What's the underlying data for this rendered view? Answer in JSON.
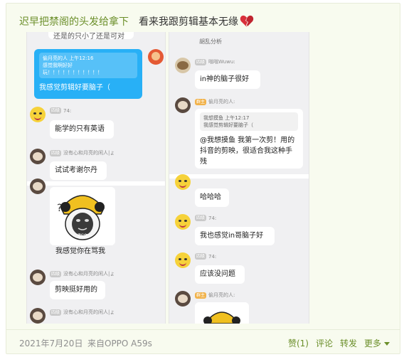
{
  "post": {
    "author": "迟早把禁阁的头发给拿下",
    "text": "看来我跟剪辑基本无缘",
    "heart_icon": "broken-heart-icon"
  },
  "left_screenshot": {
    "top_clip": "还是的只小了还是可对",
    "reply": {
      "quote_header": "偷月亮的人 上午12:16",
      "quote_line1": "感觉我啊好好",
      "quote_line2": "玩！！！！！！！！！！！",
      "text": "我感觉剪辑好要脑子（"
    },
    "msg1": {
      "level": "四级",
      "meta": "74:",
      "text": "能学的只有英语"
    },
    "msg2": {
      "level": "四级",
      "meta": "没有心和月亮的闲人|ょ",
      "text": "试试考谢尔丹"
    },
    "sticker": {
      "caption": "剩这"
    },
    "msg3": {
      "text": "我感觉你在骂我"
    },
    "msg4": {
      "level": "四级",
      "meta": "没有心和月亮的闲人|ょ",
      "text": "剪映挺好用的"
    },
    "msg5": {
      "level": "四级",
      "meta": "没有心和月亮的闲人|ょ"
    }
  },
  "right_screenshot": {
    "top_clip": "胡乱分析",
    "msg1": {
      "level": "四级",
      "meta": "嗡嗡Wuwu:",
      "text": "in神的脑子很好"
    },
    "msg2": {
      "level": "群主",
      "meta": "偷月亮的人:",
      "quote_header": "我想摸鱼 上午12:17",
      "quote_line": "我感觉剪辑好要脑子（",
      "text": "@我想摸鱼 我第一次剪！用的抖音的剪映，很适合我这种手残"
    },
    "msg3": {
      "text": "哈哈哈"
    },
    "msg4": {
      "level": "四级",
      "meta": "74:",
      "text": "我也感觉in哥脑子好"
    },
    "msg5": {
      "level": "四级",
      "meta": "74:",
      "text": "应该没问题"
    },
    "msg6": {
      "level": "群主",
      "meta": "偷月亮的人:"
    }
  },
  "footer": {
    "date": "2021年7月20日",
    "source": "来自OPPO A59s",
    "like": "赞(1)",
    "comment": "评论",
    "repost": "转发",
    "more": "更多"
  }
}
